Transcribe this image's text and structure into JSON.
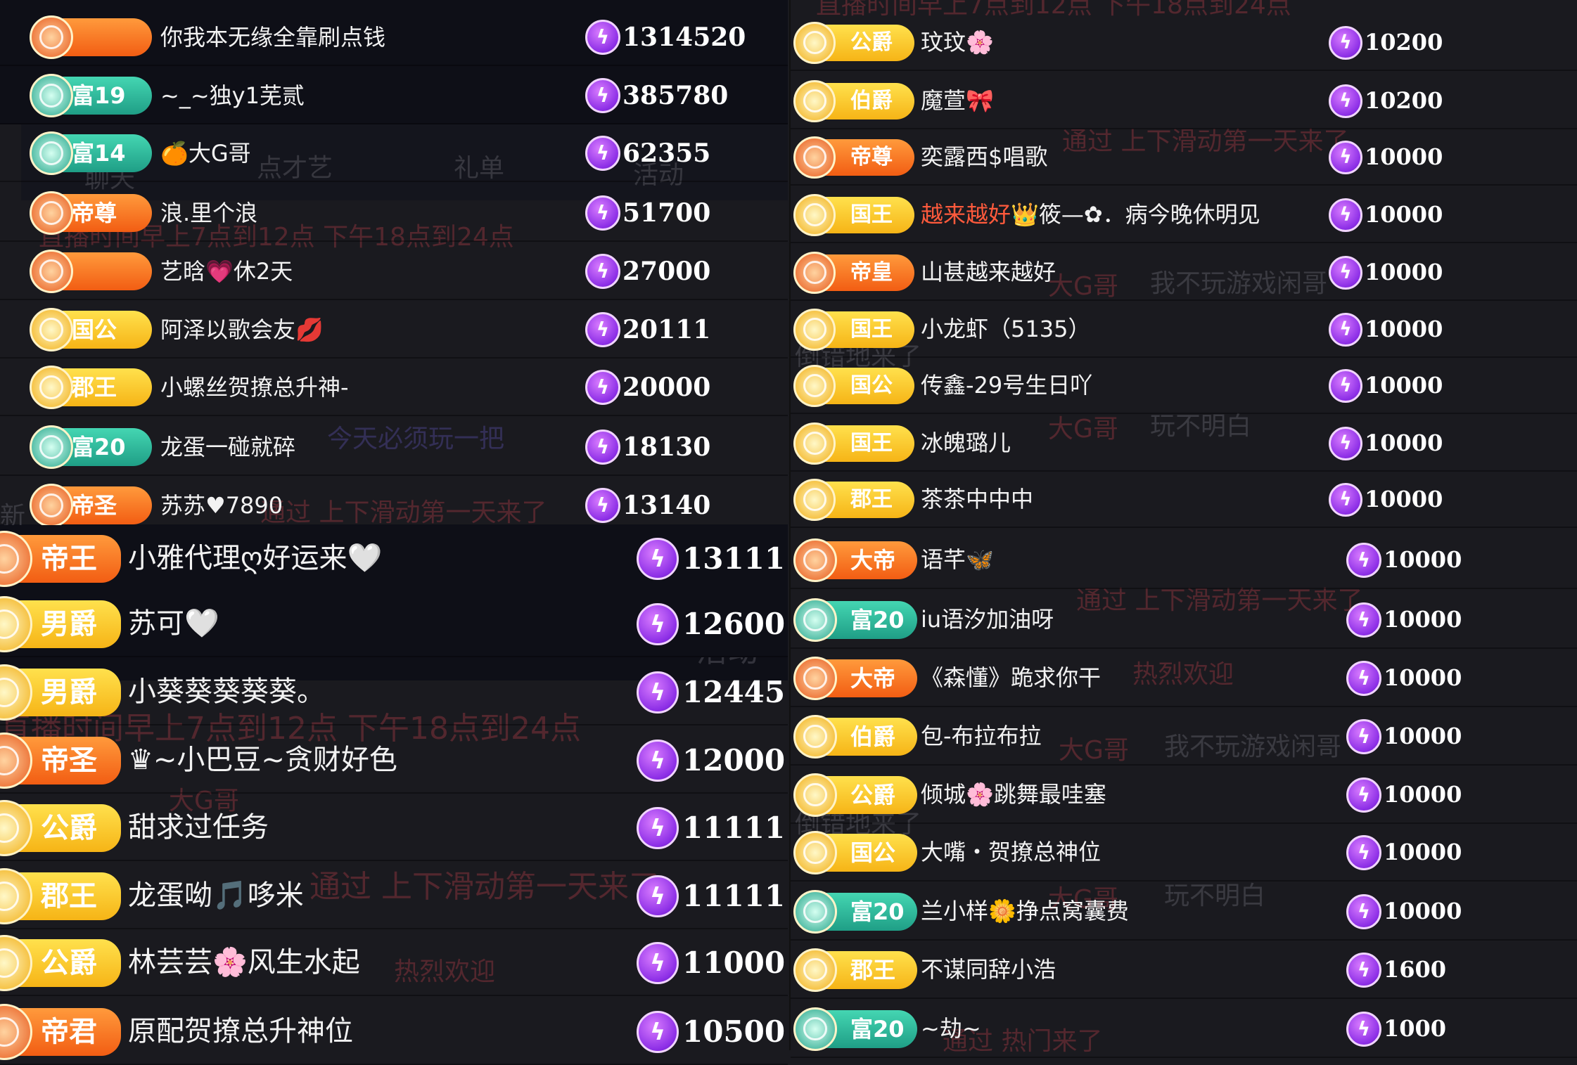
{
  "ghost_overlays": [
    {
      "text": "直播时间早上7点到12点 下午18点到24点",
      "color": "red"
    },
    {
      "text": "点才艺"
    },
    {
      "text": "礼单"
    },
    {
      "text": "活动"
    },
    {
      "text": "聊天"
    },
    {
      "text": "通过 上下滑动第一天来了"
    },
    {
      "text": "今天必须玩一把"
    },
    {
      "text": "大G哥"
    },
    {
      "text": "我不玩游戏闲哥"
    },
    {
      "text": "玩不明白"
    },
    {
      "text": "热烈欢迎"
    },
    {
      "text": "通过 热门来了"
    },
    {
      "text": "倒错地来了"
    },
    {
      "text": "新"
    }
  ],
  "left_top": {
    "rows": [
      {
        "badge": "",
        "badge_color": "orange",
        "name": "你我本无缘全靠刷点钱",
        "amount": "1314520"
      },
      {
        "badge": "富19",
        "badge_color": "teal",
        "name": "~_~独y1芜贰",
        "amount": "385780"
      },
      {
        "badge": "富14",
        "badge_color": "teal",
        "name": "🍊大G哥",
        "amount": "62355"
      },
      {
        "badge": "帝尊",
        "badge_color": "orange",
        "name": "浪.里个浪",
        "amount": "51700"
      },
      {
        "badge": "",
        "badge_color": "orange",
        "name": "艺晗💗休2天",
        "amount": "27000"
      },
      {
        "badge": "国公",
        "badge_color": "gold",
        "name": "阿泽以歌会友💋",
        "amount": "20111"
      },
      {
        "badge": "郡王",
        "badge_color": "gold",
        "name": "小螺丝贺撩总升神-",
        "amount": "20000"
      },
      {
        "badge": "富20",
        "badge_color": "teal",
        "name": "龙蛋一碰就碎",
        "amount": "18130"
      },
      {
        "badge": "帝圣",
        "badge_color": "orange",
        "name": "苏苏♥7890",
        "amount": "13140"
      }
    ]
  },
  "left_bottom": {
    "rows": [
      {
        "badge": "帝王",
        "badge_color": "orange",
        "name": "小雅代理ღ好运来🤍",
        "amount": "13111"
      },
      {
        "badge": "男爵",
        "badge_color": "gold",
        "name": "苏可🤍",
        "amount": "12600"
      },
      {
        "badge": "男爵",
        "badge_color": "gold",
        "name": "小葵葵葵葵葵。",
        "amount": "12445"
      },
      {
        "badge": "帝圣",
        "badge_color": "orange",
        "name": "♛~小巴豆~贪财好色",
        "amount": "12000"
      },
      {
        "badge": "公爵",
        "badge_color": "gold",
        "name": "甜求过任务",
        "amount": "11111"
      },
      {
        "badge": "郡王",
        "badge_color": "gold",
        "name": "龙蛋呦🎵哆米",
        "amount": "11111"
      },
      {
        "badge": "公爵",
        "badge_color": "gold",
        "name": "林芸芸🌸风生水起",
        "amount": "11000"
      },
      {
        "badge": "帝君",
        "badge_color": "orange",
        "name": "原配贺撩总升神位",
        "amount": "10500"
      }
    ]
  },
  "right_top": {
    "rows": [
      {
        "badge": "公爵",
        "badge_color": "gold",
        "name": "玟玟🌸",
        "amount": "10200"
      },
      {
        "badge": "伯爵",
        "badge_color": "gold",
        "name": "魔萱🎀",
        "amount": "10200"
      },
      {
        "badge": "帝尊",
        "badge_color": "orange",
        "name": "奕露西$唱歌",
        "amount": "10000"
      },
      {
        "badge": "国王",
        "badge_color": "gold",
        "name": "越来越好👑筱—✿．病今晚休明见",
        "name_highlight": "越来越好",
        "amount": "10000"
      },
      {
        "badge": "帝皇",
        "badge_color": "orange",
        "name": "山甚越来越好",
        "amount": "10000"
      },
      {
        "badge": "国王",
        "badge_color": "gold",
        "name": "小龙虾（5135）",
        "amount": "10000"
      },
      {
        "badge": "国公",
        "badge_color": "gold",
        "name": "传鑫-29号生日吖",
        "amount": "10000"
      },
      {
        "badge": "国王",
        "badge_color": "gold",
        "name": "冰魄璐儿",
        "amount": "10000"
      },
      {
        "badge": "郡王",
        "badge_color": "gold",
        "name": "茶茶中中中",
        "amount": "10000"
      }
    ]
  },
  "right_bottom": {
    "rows": [
      {
        "badge": "大帝",
        "badge_color": "orange",
        "name": "语芊🦋",
        "amount": "10000"
      },
      {
        "badge": "富20",
        "badge_color": "teal",
        "name": "iu语汐加油呀",
        "amount": "10000"
      },
      {
        "badge": "大帝",
        "badge_color": "orange",
        "name": "《森懂》跪求你干",
        "amount": "10000"
      },
      {
        "badge": "伯爵",
        "badge_color": "gold",
        "name": "包-布拉布拉",
        "amount": "10000"
      },
      {
        "badge": "公爵",
        "badge_color": "gold",
        "name": "倾城🌸跳舞最哇塞",
        "amount": "10000"
      },
      {
        "badge": "国公",
        "badge_color": "gold",
        "name": "大嘴・贺撩总神位",
        "amount": "10000"
      },
      {
        "badge": "富20",
        "badge_color": "teal",
        "name": "兰小样🌼挣点窝囊费",
        "amount": "10000"
      },
      {
        "badge": "郡王",
        "badge_color": "gold",
        "name": "不谋同辞小浩",
        "amount": "1600"
      },
      {
        "badge": "富20",
        "badge_color": "teal",
        "name": "~劫~",
        "amount": "1000"
      }
    ]
  },
  "icons": {
    "currency": "lightning-coin-icon",
    "rank_emblem": "rank-emblem-icon"
  }
}
